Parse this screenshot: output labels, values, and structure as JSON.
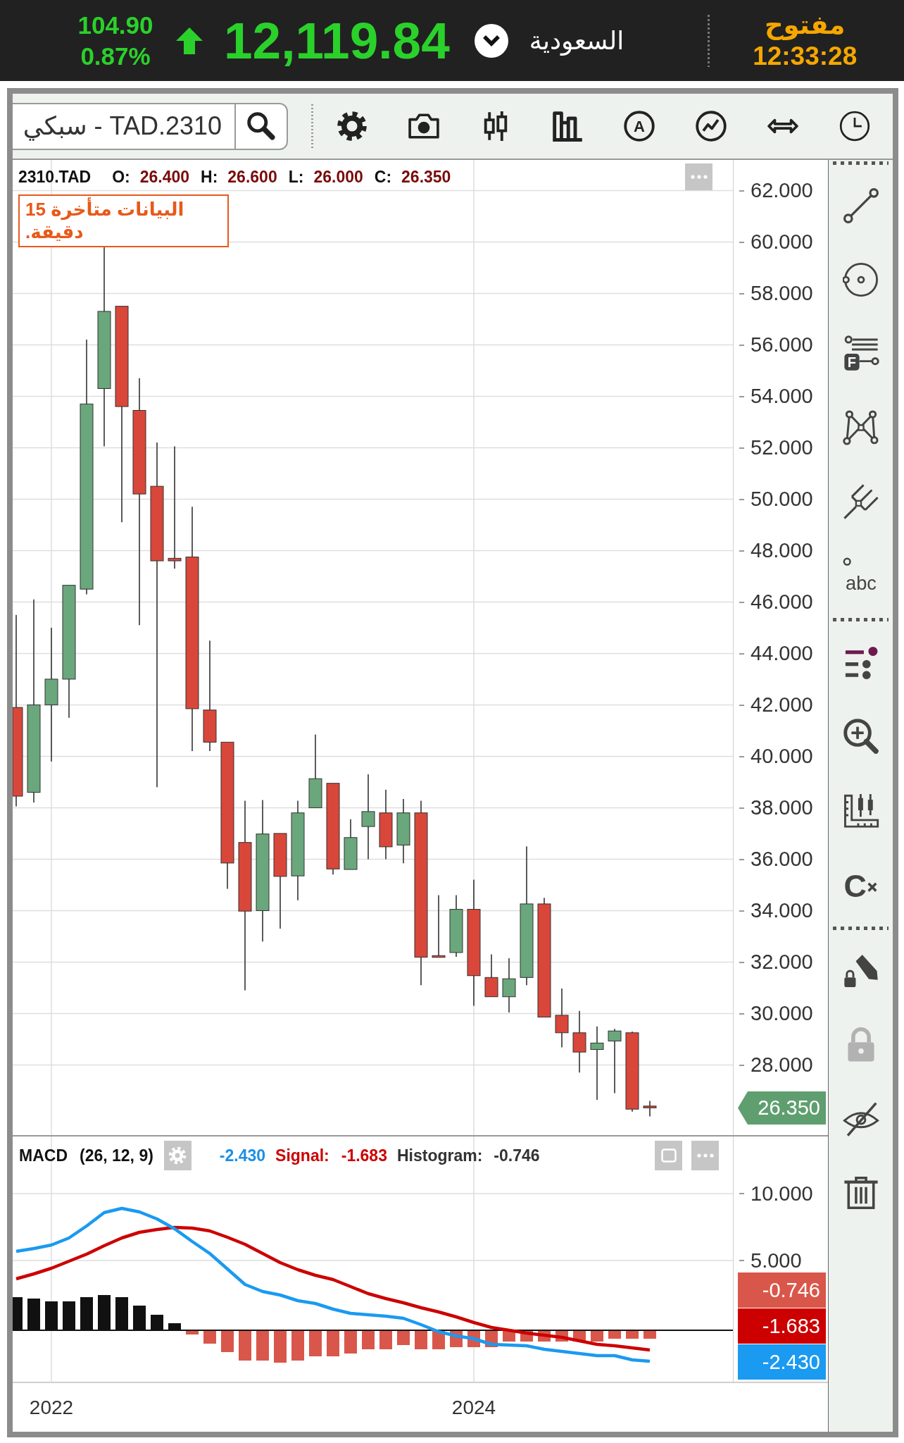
{
  "ticker_bar": {
    "change": "104.90",
    "change_percent": "0.87%",
    "up": true,
    "index_value": "12,119.84",
    "market": "السعودية",
    "market_status": "مفتوح",
    "time": "12:33:28"
  },
  "toolbar": {
    "symbol_field": {
      "value": "سبكي - TAD.2310"
    },
    "tools": [
      {
        "kind": "settings"
      },
      {
        "kind": "screenshot"
      },
      {
        "kind": "chart_type"
      },
      {
        "kind": "volume"
      },
      {
        "kind": "auto",
        "label": "A"
      },
      {
        "kind": "indicators"
      },
      {
        "kind": "fit"
      },
      {
        "kind": "time"
      }
    ]
  },
  "price_chart": {
    "symbol": "2310.TAD",
    "ohlc": [
      {
        "label": "O:",
        "value": "26.400"
      },
      {
        "label": "H:",
        "value": "26.600"
      },
      {
        "label": "L:",
        "value": "26.000"
      },
      {
        "label": "C:",
        "value": "26.350"
      }
    ],
    "delay_notice": "البيانات متأخرة 15 دقيقة.",
    "axis_labels": [
      "62.000",
      "60.000",
      "58.000",
      "56.000",
      "54.000",
      "52.000",
      "50.000",
      "48.000",
      "46.000",
      "44.000",
      "42.000",
      "40.000",
      "38.000",
      "36.000",
      "34.000",
      "32.000",
      "30.000",
      "28.000"
    ],
    "last_price": "26.350"
  },
  "macd": {
    "title": "MACD",
    "params": "(26, 12, 9)",
    "macd_value": "-2.430",
    "signal_label": "Signal:",
    "signal_value": "-1.683",
    "histogram_label": "Histogram:",
    "histogram_value": "-0.746",
    "axis_labels": [
      "10.000",
      "5.000"
    ],
    "value_tags": [
      {
        "kind": "histogram",
        "value": "-0.746"
      },
      {
        "kind": "signal",
        "value": "-1.683"
      },
      {
        "kind": "macd",
        "value": "-2.430"
      }
    ]
  },
  "time_axis": {
    "labels": [
      "2022",
      "2024"
    ]
  },
  "drawing_tools": [
    {
      "tools": [
        {
          "kind": "line",
          "disabled": false
        },
        {
          "kind": "circle",
          "disabled": false
        },
        {
          "kind": "fibonacci",
          "label": "F",
          "disabled": false
        },
        {
          "kind": "pattern",
          "disabled": false
        },
        {
          "kind": "pitchfork",
          "disabled": false
        },
        {
          "kind": "text",
          "label": "abc",
          "disabled": false
        }
      ]
    },
    {
      "tools": [
        {
          "kind": "indicators",
          "disabled": false
        },
        {
          "kind": "zoom",
          "disabled": false
        },
        {
          "kind": "measure",
          "disabled": false
        },
        {
          "kind": "clear",
          "label": "C",
          "disabled": false
        }
      ]
    },
    {
      "tools": [
        {
          "kind": "draw_lock",
          "disabled": false
        },
        {
          "kind": "lock",
          "disabled": true
        },
        {
          "kind": "hide",
          "disabled": false
        },
        {
          "kind": "delete",
          "disabled": false
        }
      ]
    }
  ]
}
